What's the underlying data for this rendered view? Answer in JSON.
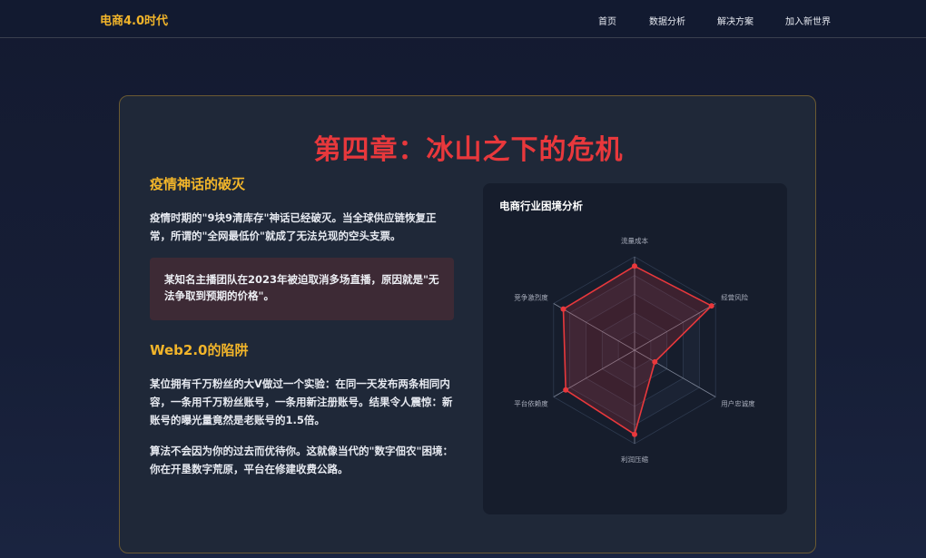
{
  "nav": {
    "brand": "电商4.0时代",
    "links": [
      "首页",
      "数据分析",
      "解决方案",
      "加入新世界"
    ]
  },
  "chapter": {
    "title": "第四章：冰山之下的危机",
    "section1": {
      "heading": "疫情神话的破灭",
      "paragraph": "疫情时期的\"9块9清库存\"神话已经破灭。当全球供应链恢复正常，所谓的\"全网最低价\"就成了无法兑现的空头支票。",
      "quote": "某知名主播团队在2023年被迫取消多场直播，原因就是\"无法争取到预期的价格\"。"
    },
    "section2": {
      "heading": "Web2.0的陷阱",
      "paragraph1": "某位拥有千万粉丝的大V做过一个实验：在同一天发布两条相同内容，一条用千万粉丝账号，一条用新注册账号。结果令人震惊：新账号的曝光量竟然是老账号的1.5倍。",
      "paragraph2": "算法不会因为你的过去而优待你。这就像当代的\"数字佃农\"困境：你在开垦数字荒原，平台在修建收费公路。"
    }
  },
  "colors": {
    "accent": "#f2b52a",
    "title_red": "#e8383c",
    "series": "#e8383c"
  },
  "chart_data": {
    "type": "radar",
    "title": "电商行业困境分析",
    "categories": [
      "流量成本",
      "经营风险",
      "用户忠诚度",
      "利润压缩",
      "平台依赖度",
      "竞争激烈度"
    ],
    "series": [
      {
        "values": [
          90,
          95,
          25,
          90,
          85,
          88
        ]
      }
    ],
    "max": 100,
    "grid": true,
    "legend": "none"
  }
}
